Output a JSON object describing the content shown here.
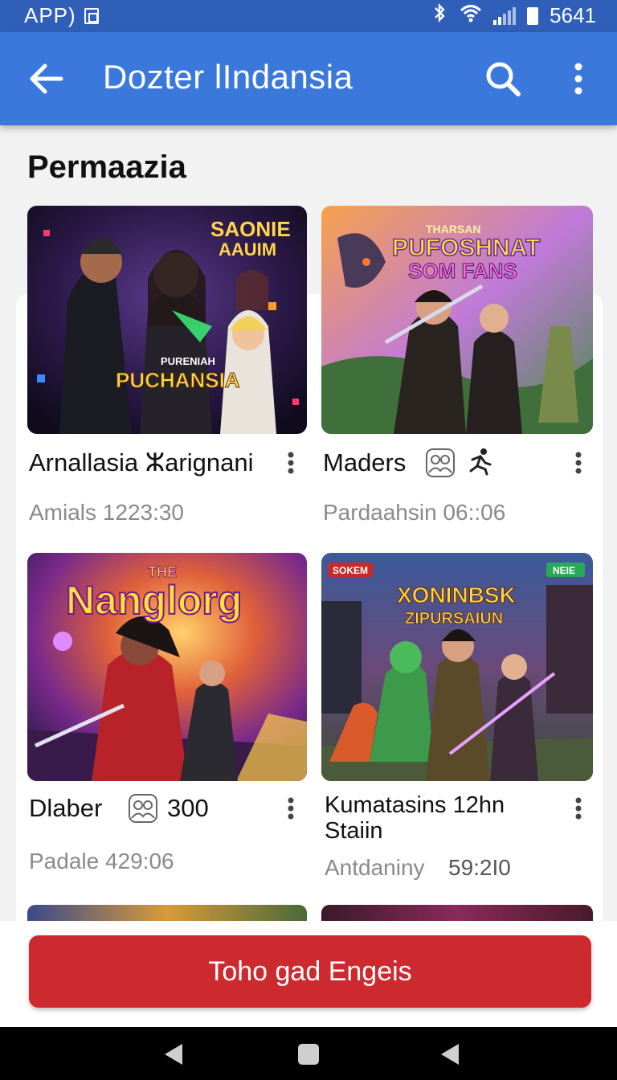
{
  "status_bar": {
    "left_text": "APP)",
    "time": "5641",
    "icons": [
      "bluetooth-icon",
      "wifi-icon",
      "signal-icon",
      "battery-icon"
    ]
  },
  "app_bar": {
    "title": "Dozter lIndansia",
    "icons": [
      "back-arrow-icon",
      "search-icon",
      "more-vert-icon"
    ]
  },
  "section": {
    "title": "Permaazia"
  },
  "cards": [
    {
      "title": "Arnallasia ⵣarignani",
      "meta": "Amials 1223:30",
      "art_text": [
        "SAONIE",
        "AAUIM",
        "PURENIAH",
        "PUCHANSIA"
      ]
    },
    {
      "title": "Maders",
      "meta": "Pardaahsin 06::06",
      "art_text": [
        "THARSAN",
        "PUFOSHNAT",
        "SOM FANS"
      ],
      "icons": [
        "group-icon",
        "run-icon"
      ]
    },
    {
      "title": "Dlaber",
      "count": "300",
      "meta": "Padale 429:06",
      "art_text": [
        "THE",
        "Nanglorg"
      ],
      "icons": [
        "group-icon"
      ]
    },
    {
      "title_line1": "Kumatasins 12hn",
      "title_line2": "Staiin",
      "meta_left": "Antdaniny",
      "meta_right": "59:2I0",
      "art_text": [
        "SOKEM",
        "NEIE",
        "XONINBSK",
        "ZIPURSAIUN"
      ]
    }
  ],
  "cta": {
    "label": "Toho gad Engeis"
  },
  "colors": {
    "app_bar": "#3a78dc",
    "status_bar": "#2f5fb8",
    "cta": "#cc2a2f"
  }
}
